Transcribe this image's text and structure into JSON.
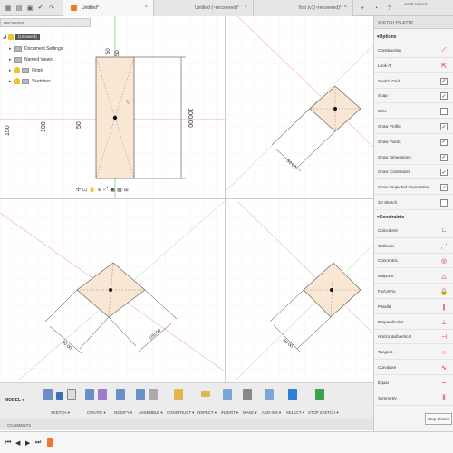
{
  "tabs": [
    {
      "label": "Untitled*"
    },
    {
      "label": "Untitled (~recovered)*"
    },
    {
      "label": "first (v1)~recovered)*"
    }
  ],
  "user": "Amal Ashour",
  "browser": {
    "header": "BROWSER",
    "root": "(Unsaved)",
    "items": [
      "Document Settings",
      "Named Views",
      "Origin",
      "Sketches"
    ]
  },
  "dims": {
    "top_a": "50",
    "top_b": "50",
    "width": "100.00",
    "ruler_150": "150",
    "ruler_100": "100",
    "ruler_50": "50",
    "tr": "50.00",
    "bl_a": "50.00",
    "bl_b": "100.00",
    "br": "50.00"
  },
  "palette": {
    "title": "SKETCH PALETTE",
    "options_label": "Options",
    "options": [
      {
        "label": "Construction",
        "control": "construction-icon"
      },
      {
        "label": "Look At",
        "control": "look-at-icon"
      },
      {
        "label": "Sketch Grid",
        "control": "checkbox",
        "checked": true
      },
      {
        "label": "Snap",
        "control": "checkbox",
        "checked": true
      },
      {
        "label": "Slice",
        "control": "checkbox",
        "checked": false
      },
      {
        "label": "Show Profile",
        "control": "checkbox",
        "checked": true
      },
      {
        "label": "Show Points",
        "control": "checkbox",
        "checked": true
      },
      {
        "label": "Show Dimensions",
        "control": "checkbox",
        "checked": true
      },
      {
        "label": "Show Constraints",
        "control": "checkbox",
        "checked": true
      },
      {
        "label": "Show Projected Geometries",
        "control": "checkbox",
        "checked": true
      },
      {
        "label": "3D Sketch",
        "control": "checkbox",
        "checked": false
      }
    ],
    "constraints_label": "Constraints",
    "constraints": [
      {
        "label": "Coincident",
        "icon": "coincident-icon",
        "glyph": "∟"
      },
      {
        "label": "Collinear",
        "icon": "collinear-icon",
        "glyph": "⋰"
      },
      {
        "label": "Concentric",
        "icon": "concentric-icon",
        "glyph": "◎"
      },
      {
        "label": "Midpoint",
        "icon": "midpoint-icon",
        "glyph": "△"
      },
      {
        "label": "Fix/UnFix",
        "icon": "lock-icon",
        "glyph": "🔒"
      },
      {
        "label": "Parallel",
        "icon": "parallel-icon",
        "glyph": "∥"
      },
      {
        "label": "Perpendicular",
        "icon": "perpendicular-icon",
        "glyph": "⊥"
      },
      {
        "label": "Horizontal/Vertical",
        "icon": "horizontal-vertical-icon",
        "glyph": "⊣"
      },
      {
        "label": "Tangent",
        "icon": "tangent-icon",
        "glyph": "○"
      },
      {
        "label": "Curvature",
        "icon": "curvature-icon",
        "glyph": "∿"
      },
      {
        "label": "Equal",
        "icon": "equal-icon",
        "glyph": "="
      },
      {
        "label": "Symmetry",
        "icon": "symmetry-icon",
        "glyph": "⫼"
      }
    ],
    "stop_label": "Stop Sketch"
  },
  "toolbar": {
    "model": "MODEL",
    "groups": [
      "SKETCH",
      "CREATE",
      "MODIFY",
      "ASSEMBLE",
      "CONSTRUCT",
      "INSPECT",
      "INSERT",
      "MAKE",
      "ADD-INS",
      "SELECT",
      "STOP SKETCH"
    ]
  },
  "comments": "COMMENTS",
  "colors": {
    "accent": "#f0772b",
    "red_axis": "#e55",
    "green_axis": "#5c5",
    "fill": "#f9e7d3"
  }
}
